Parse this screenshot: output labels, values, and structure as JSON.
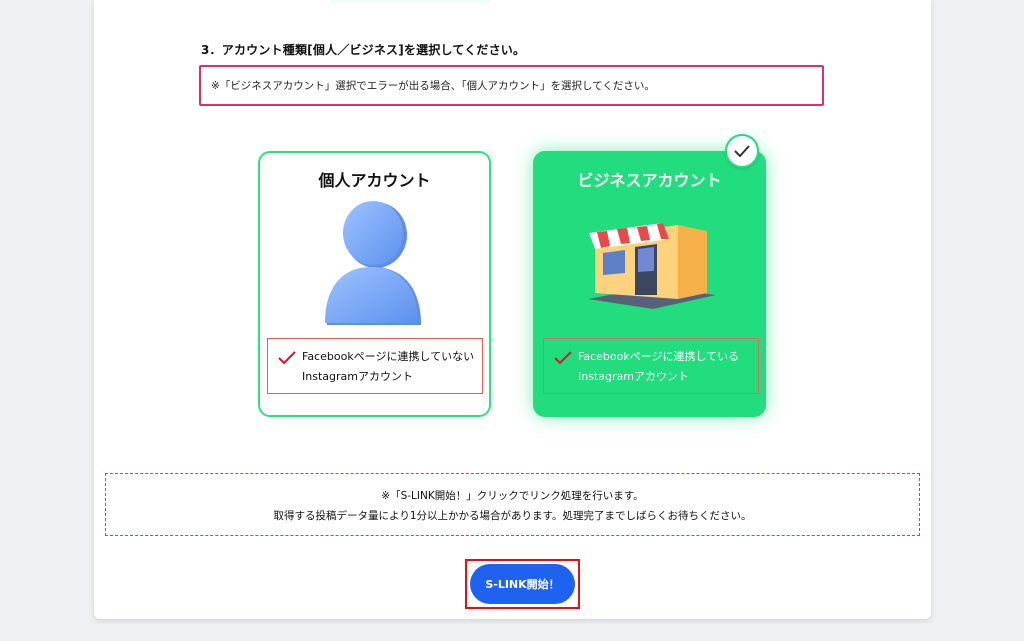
{
  "step": {
    "title": "3．アカウント種類[個人／ビジネス]を選択してください。",
    "warning": "※「ビジネスアカウント」選択でエラーが出る場合、「個人アカウント」を選択してください。"
  },
  "cards": [
    {
      "title": "個人アカウント",
      "desc_line1": "Facebookページに連携していない",
      "desc_line2": "Instagramアカウント",
      "selected": false,
      "icon": "person-icon"
    },
    {
      "title": "ビジネスアカウント",
      "desc_line1": "Facebookページに連携している",
      "desc_line2": "Instagramアカウント",
      "selected": true,
      "icon": "shop-icon"
    }
  ],
  "info": {
    "line1": "※「S-LINK開始！」クリックでリンク処理を行います。",
    "line2": "取得する投稿データ量により1分以上かかる場合があります。処理完了までしばらくお待ちください。"
  },
  "start_button": {
    "label": "S-LINK開始！"
  },
  "colors": {
    "accent_green": "#22dd7e",
    "warning_border": "#d6336c",
    "primary_blue": "#2062f0",
    "highlight_red": "#e0101f"
  }
}
